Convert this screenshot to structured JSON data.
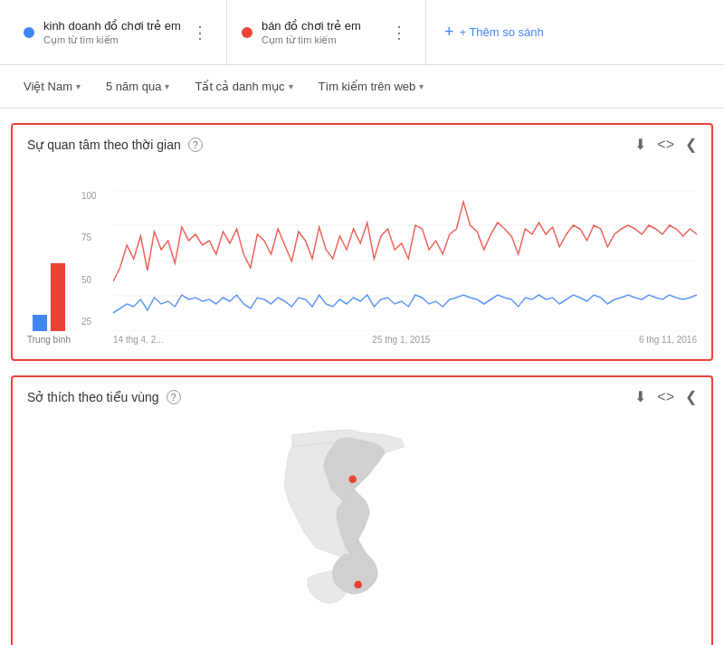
{
  "tabs": [
    {
      "id": "tab1",
      "color": "blue",
      "title": "kinh doanh đồ chơi trẻ em",
      "subtitle": "Cụm từ tìm kiếm"
    },
    {
      "id": "tab2",
      "color": "red",
      "title": "bán đồ chơi trẻ em",
      "subtitle": "Cụm từ tìm kiếm"
    }
  ],
  "add_compare_label": "+ Thêm so sánh",
  "filters": [
    {
      "id": "region",
      "label": "Việt Nam"
    },
    {
      "id": "period",
      "label": "5 năm qua"
    },
    {
      "id": "category",
      "label": "Tất cả danh mục"
    },
    {
      "id": "search_type",
      "label": "Tìm kiếm trên web"
    }
  ],
  "sections": {
    "interest_over_time": {
      "title": "Sự quan tâm theo thời gian",
      "avg_label": "Trung bình",
      "y_labels": [
        "100",
        "75",
        "50",
        "25"
      ],
      "x_labels": [
        "14 thg 4, 2...",
        "25 thg 1, 2015",
        "6 thg 11, 2016"
      ],
      "download_icon": "⬇",
      "code_icon": "<>",
      "share_icon": "≪"
    },
    "interest_by_subregion": {
      "title": "Sở thích theo tiểu vùng",
      "download_icon": "⬇",
      "code_icon": "<>",
      "share_icon": "≪"
    }
  },
  "colors": {
    "blue": "#4285f4",
    "red": "#ea4335",
    "border_red": "#ea4335",
    "grid": "#e8e8e8",
    "bg": "#fff"
  }
}
